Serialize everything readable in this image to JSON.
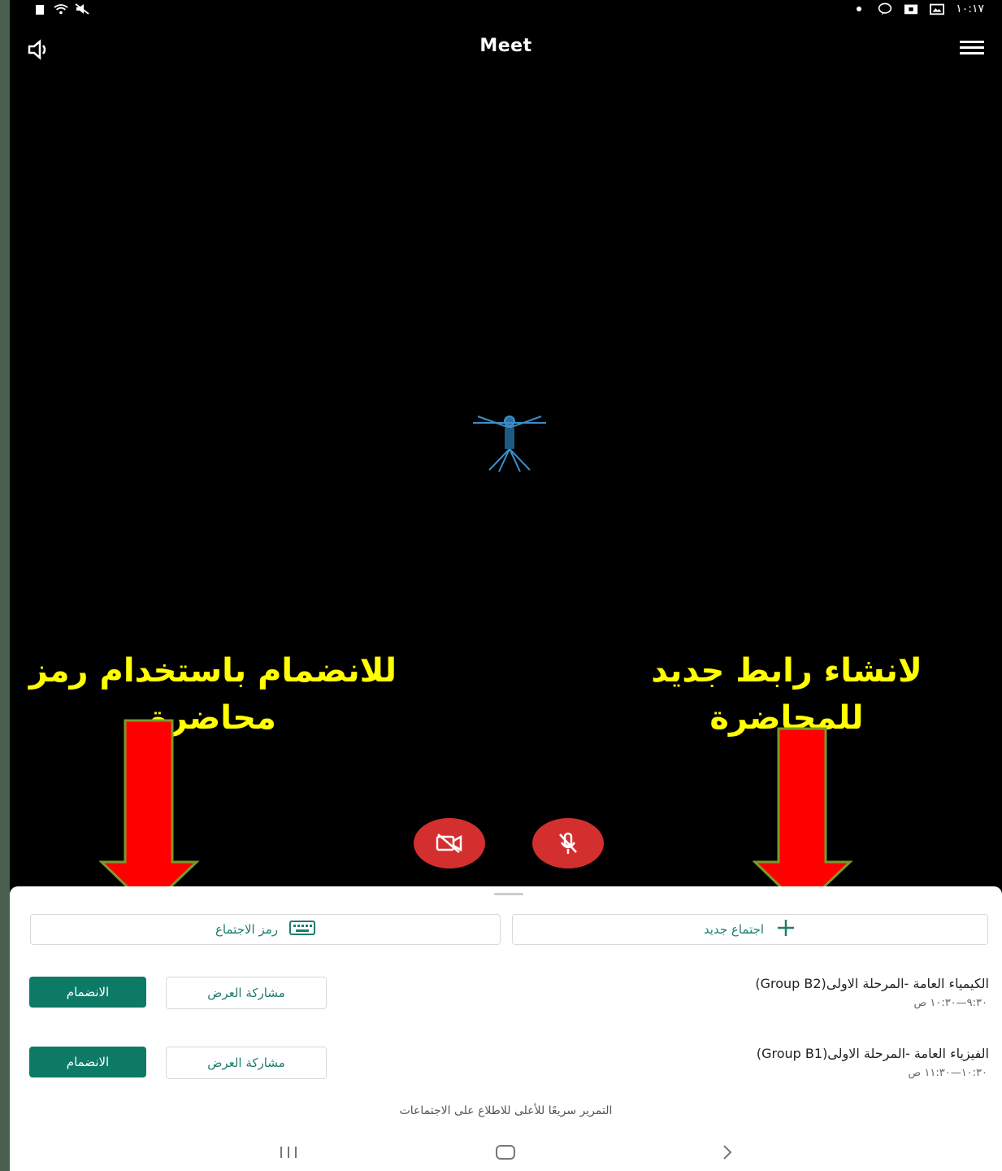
{
  "status_bar": {
    "time": "١٠:١٧"
  },
  "app": {
    "title": "Meet"
  },
  "annotations": {
    "right_line1": "لانشاء رابط جديد",
    "right_line2": "للمحاضرة",
    "left_line1": "للانضمام باستخدام رمز",
    "left_line2": "محاضرة"
  },
  "actions": {
    "new_meeting": "اجتماع جديد",
    "meeting_code": "رمز الاجتماع"
  },
  "meetings": [
    {
      "title": "الكيمياء العامة -المرحلة الاولى(Group B2)",
      "time": "٩:٣٠—١٠:٣٠ ص",
      "present_label": "مشاركة العرض",
      "join_label": "الانضمام"
    },
    {
      "title": "الفيزياء العامة -المرحلة الاولى(Group B1)",
      "time": "١٠:٣٠—١١:٣٠ ص",
      "present_label": "مشاركة العرض",
      "join_label": "الانضمام"
    }
  ],
  "hint": "التمرير سريعًا للأعلى للاطلاع على الاجتماعات",
  "colors": {
    "accent": "#0d7a66",
    "control_red": "#d32f2f",
    "annotation": "#ffff00",
    "arrow": "#ff0000"
  }
}
